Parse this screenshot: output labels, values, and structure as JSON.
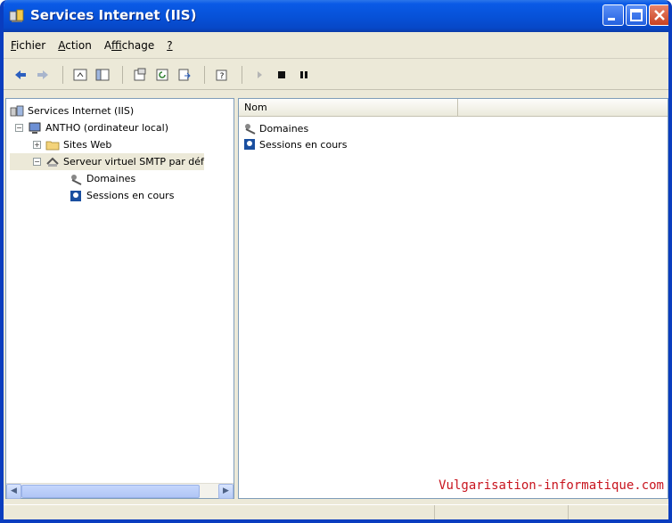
{
  "window": {
    "title": "Services Internet (IIS)"
  },
  "menu": [
    {
      "label": "Fichier",
      "accel": "F"
    },
    {
      "label": "Action",
      "accel": "A"
    },
    {
      "label": "Affichage",
      "accel": "f"
    },
    {
      "label": "?",
      "accel": "?"
    }
  ],
  "toolbar": {
    "icons": [
      "back-arrow-icon",
      "forward-arrow-icon",
      "up-level-icon",
      "show-tree-icon",
      "properties-icon",
      "refresh-icon",
      "export-list-icon",
      "help-icon",
      "play-icon",
      "stop-icon",
      "pause-icon"
    ]
  },
  "tree": {
    "root": "Services Internet (IIS)",
    "computer": "ANTHO (ordinateur local)",
    "sites": "Sites Web",
    "smtp": "Serveur virtuel SMTP par déf",
    "domains": "Domaines",
    "sessions": "Sessions en cours"
  },
  "list": {
    "column_name": "Nom",
    "items": [
      "Domaines",
      "Sessions en cours"
    ]
  },
  "watermark": "Vulgarisation-informatique.com",
  "colors": {
    "title_bar": "#0752d9",
    "watermark": "#c8141e"
  }
}
